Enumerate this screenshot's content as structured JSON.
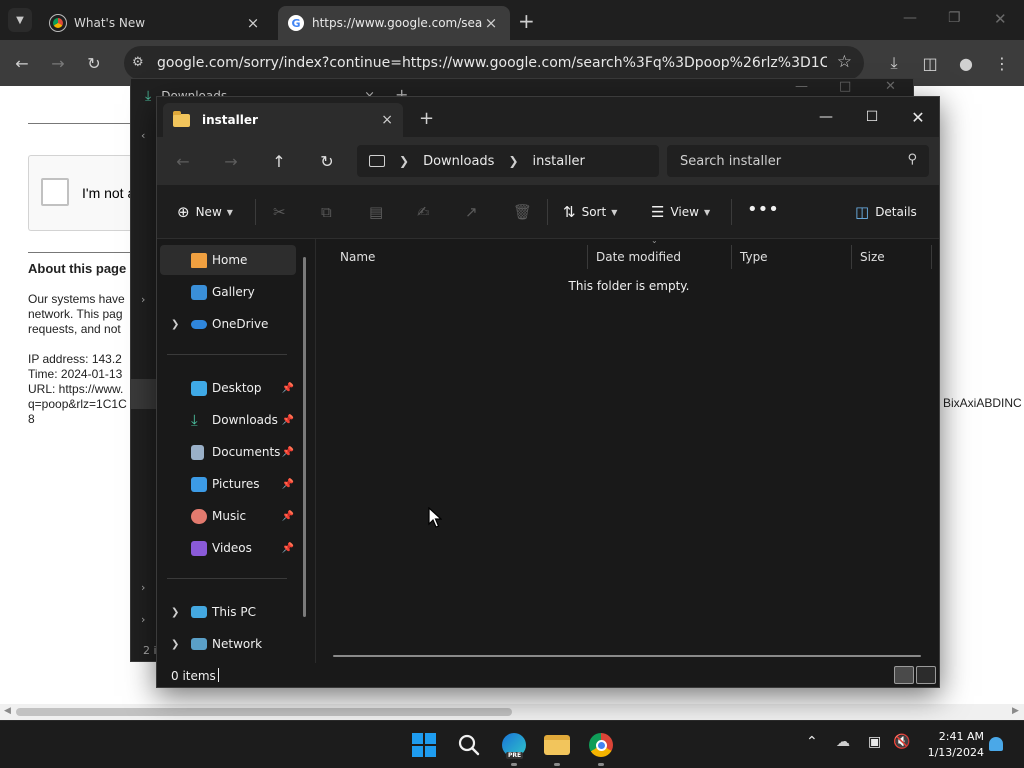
{
  "chrome": {
    "tabs": [
      {
        "title": "What's New",
        "active": false
      },
      {
        "title": "https://www.google.com/search",
        "active": true
      }
    ],
    "address": "google.com/sorry/index?continue=https://www.google.com/search%3Fq%3Dpoop%26rlz%3D1C1GCEA_en..."
  },
  "webpage": {
    "captcha_label": "I'm not a",
    "about_heading": "About this page",
    "paragraph": [
      "Our systems have",
      "network. This pag",
      "requests, and not"
    ],
    "details": [
      "IP address: 143.2",
      "Time: 2024-01-13",
      "URL: https://www.",
      "q=poop&rlz=1C1C",
      "8"
    ],
    "right_fragment": "BixAxiABDINC"
  },
  "background_window": {
    "tab_title": "Downloads",
    "footer": "2 i"
  },
  "explorer": {
    "tab_title": "installer",
    "breadcrumb": [
      "Downloads",
      "installer"
    ],
    "search_placeholder": "Search installer",
    "commands": {
      "new": "New",
      "sort": "Sort",
      "view": "View",
      "details": "Details"
    },
    "nav": {
      "home": "Home",
      "gallery": "Gallery",
      "onedrive": "OneDrive",
      "desktop": "Desktop",
      "downloads": "Downloads",
      "documents": "Documents",
      "pictures": "Pictures",
      "music": "Music",
      "videos": "Videos",
      "thispc": "This PC",
      "network": "Network"
    },
    "columns": [
      "Name",
      "Date modified",
      "Type",
      "Size"
    ],
    "empty_message": "This folder is empty.",
    "status": "0 items"
  },
  "taskbar": {
    "time": "2:41 AM",
    "date": "1/13/2024",
    "edge_badge": "PRE"
  },
  "colors": {
    "accent": "#1e9cf0",
    "folder": "#f2c55c",
    "downloads_green": "#4cc2a0"
  }
}
